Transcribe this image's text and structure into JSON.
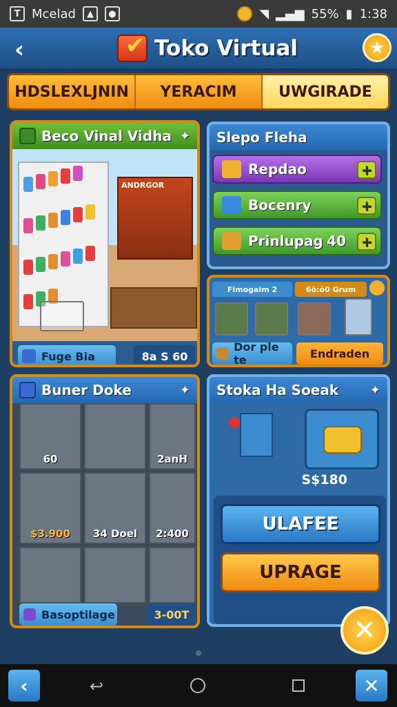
{
  "status_bar": {
    "left_label": "Mcelad",
    "battery": "55%",
    "time": "1:38"
  },
  "header": {
    "title": "Toko Virtual",
    "back_icon": "chevron-left-icon",
    "star_icon": "star-icon"
  },
  "tabs": [
    "HDSLEXLJNIN",
    "YERACIM",
    "UWGIRADE"
  ],
  "store_panel": {
    "title": "Beco Vinal Vidha",
    "footer_left": "Fuge Bia",
    "footer_right": "8a S 60",
    "stand_sign": "ANDRGOR"
  },
  "side_panel": {
    "title": "Slepo Fleha",
    "items": [
      {
        "label": "Repdao",
        "value": ""
      },
      {
        "label": "Bocenry",
        "value": ""
      },
      {
        "label": "Prinlupag",
        "value": "40"
      }
    ]
  },
  "carts_panel": {
    "tag_left": "Fimogaim 2",
    "tag_right": "6ö:õ0 Grum",
    "footer_left": "Dor ple te",
    "footer_right": "Endraden"
  },
  "buner_panel": {
    "title": "Buner Doke",
    "cells": [
      "60",
      "",
      "2anH",
      "$3.900",
      "34 Doel",
      "2:400",
      "",
      "",
      ""
    ],
    "footer_left": "Basoptilage",
    "footer_right": "3-00T"
  },
  "stock_panel": {
    "title": "Stoka Ha Soeak",
    "price": "S$180",
    "btn_primary": "ULAFEE",
    "btn_secondary": "UPRAGE"
  },
  "colors": {
    "accent_orange": "#f08d12",
    "panel_blue": "#2b5d91",
    "header_blue": "#2f6fb2"
  }
}
